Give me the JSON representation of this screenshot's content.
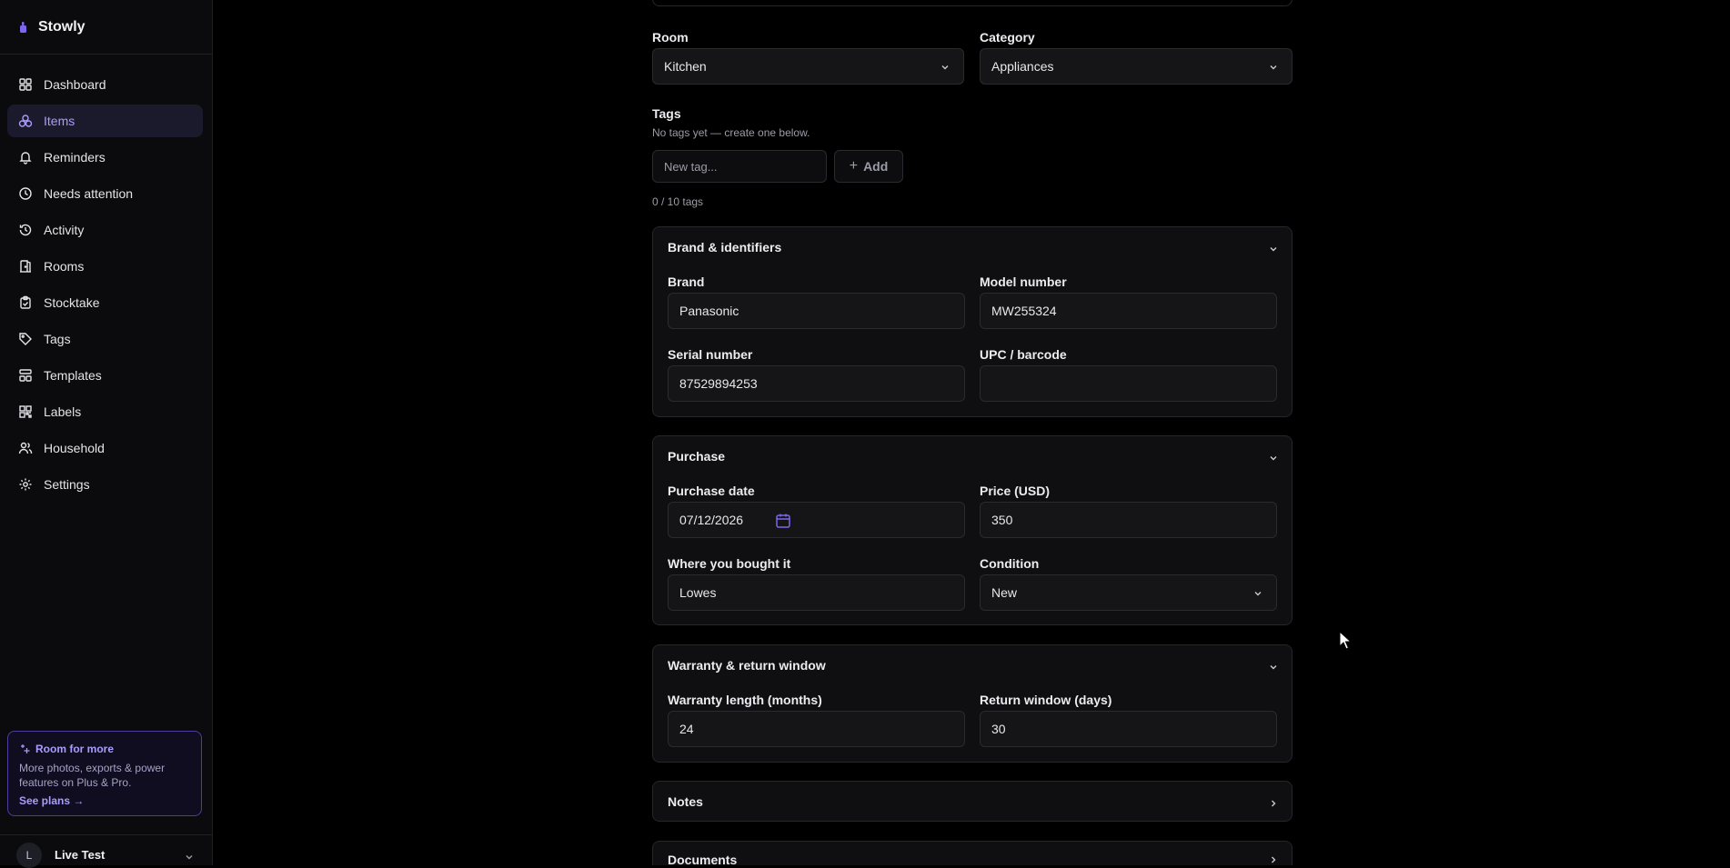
{
  "app": {
    "name": "Stowly"
  },
  "sidebar": {
    "items": [
      {
        "label": "Dashboard",
        "icon": "grid-icon",
        "active": false
      },
      {
        "label": "Items",
        "icon": "boxes-icon",
        "active": true
      },
      {
        "label": "Reminders",
        "icon": "bell-icon",
        "active": false
      },
      {
        "label": "Needs attention",
        "icon": "clock-icon",
        "active": false
      },
      {
        "label": "Activity",
        "icon": "history-icon",
        "active": false
      },
      {
        "label": "Rooms",
        "icon": "door-icon",
        "active": false
      },
      {
        "label": "Stocktake",
        "icon": "clipboard-check-icon",
        "active": false
      },
      {
        "label": "Tags",
        "icon": "tag-icon",
        "active": false
      },
      {
        "label": "Templates",
        "icon": "layout-icon",
        "active": false
      },
      {
        "label": "Labels",
        "icon": "qr-icon",
        "active": false
      },
      {
        "label": "Household",
        "icon": "users-icon",
        "active": false
      },
      {
        "label": "Settings",
        "icon": "gear-icon",
        "active": false
      }
    ],
    "promo": {
      "title": "Room for more",
      "text": "More photos, exports & power features on Plus & Pro.",
      "link": "See plans →"
    },
    "user": {
      "initial": "L",
      "name": "Live Test"
    }
  },
  "form": {
    "room": {
      "label": "Room",
      "value": "Kitchen"
    },
    "category": {
      "label": "Category",
      "value": "Appliances"
    },
    "tags": {
      "label": "Tags",
      "hint": "No tags yet — create one below.",
      "placeholder": "New tag...",
      "add_label": "Add",
      "count": "0 / 10 tags"
    },
    "brand_section": {
      "title": "Brand & identifiers",
      "brand": {
        "label": "Brand",
        "value": "Panasonic"
      },
      "model": {
        "label": "Model number",
        "value": "MW255324"
      },
      "serial": {
        "label": "Serial number",
        "value": "87529894253"
      },
      "upc": {
        "label": "UPC / barcode",
        "value": ""
      }
    },
    "purchase_section": {
      "title": "Purchase",
      "date": {
        "label": "Purchase date",
        "value": "07/12/2026"
      },
      "price": {
        "label": "Price (USD)",
        "value": "350"
      },
      "store": {
        "label": "Where you bought it",
        "value": "Lowes"
      },
      "condition": {
        "label": "Condition",
        "value": "New"
      }
    },
    "warranty_section": {
      "title": "Warranty & return window",
      "warranty": {
        "label": "Warranty length (months)",
        "value": "24"
      },
      "return_window": {
        "label": "Return window (days)",
        "value": "30"
      }
    },
    "notes_section": {
      "title": "Notes"
    },
    "documents_section": {
      "title": "Documents"
    }
  },
  "colors": {
    "accent": "#a99cff",
    "background": "#000000",
    "sidebar": "#0b0b0d"
  }
}
